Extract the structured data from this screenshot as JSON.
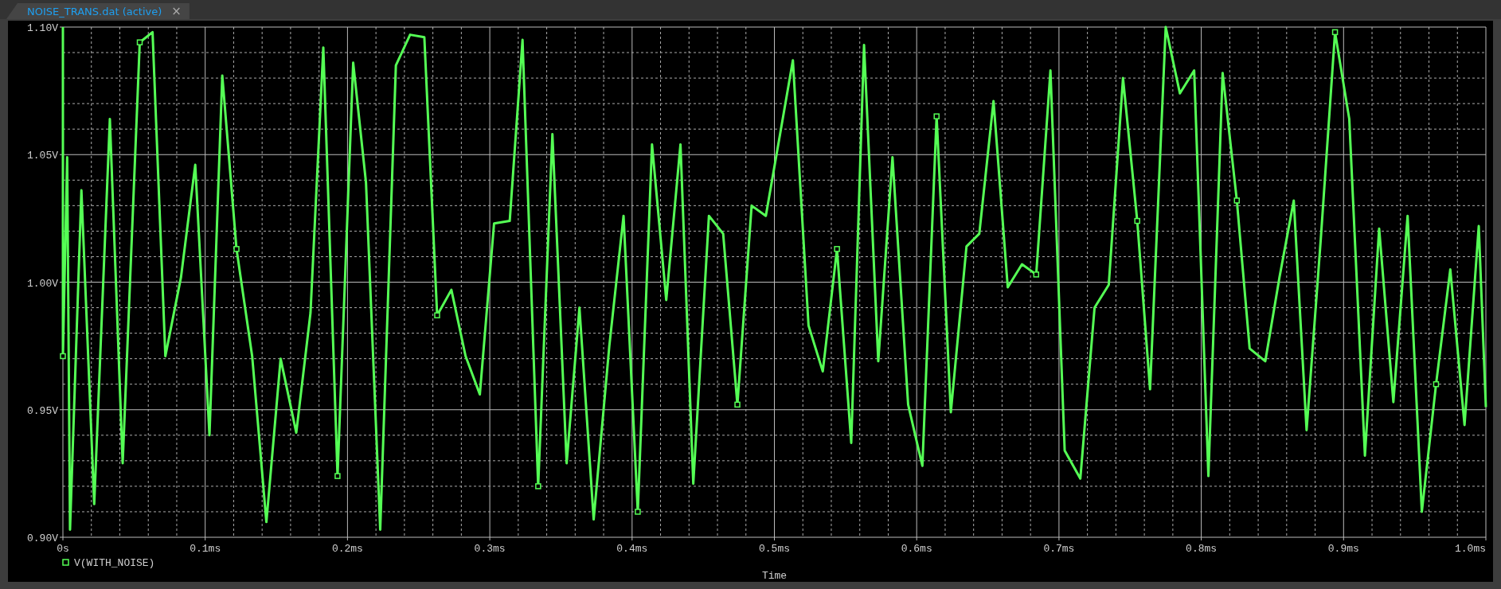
{
  "tab": {
    "title": "NOISE_TRANS.dat (active)",
    "close": "×",
    "selected": true
  },
  "chart": {
    "chart_data": {
      "type": "line",
      "grid": true,
      "xlabel": "Time",
      "xlim": [
        0,
        1
      ],
      "ylim": [
        0.9,
        1.1
      ],
      "xticks": [
        {
          "value": 0,
          "label": "0s"
        },
        {
          "value": 0.1,
          "label": "0.1ms"
        },
        {
          "value": 0.2,
          "label": "0.2ms"
        },
        {
          "value": 0.3,
          "label": "0.3ms"
        },
        {
          "value": 0.4,
          "label": "0.4ms"
        },
        {
          "value": 0.5,
          "label": "0.5ms"
        },
        {
          "value": 0.6,
          "label": "0.6ms"
        },
        {
          "value": 0.7,
          "label": "0.7ms"
        },
        {
          "value": 0.8,
          "label": "0.8ms"
        },
        {
          "value": 0.9,
          "label": "0.9ms"
        },
        {
          "value": 1,
          "label": "1.0ms"
        }
      ],
      "yticks": [
        {
          "value": 0.9,
          "label": "0.90V"
        },
        {
          "value": 0.95,
          "label": "0.95V"
        },
        {
          "value": 1,
          "label": "1.00V"
        },
        {
          "value": 1.05,
          "label": "1.05V"
        },
        {
          "value": 1.1,
          "label": "1.10V"
        }
      ],
      "x": [
        0,
        0,
        0.003,
        0.005,
        0.013,
        0.022,
        0.033,
        0.042,
        0.054,
        0.063,
        0.072,
        0.083,
        0.093,
        0.103,
        0.112,
        0.122,
        0.133,
        0.143,
        0.153,
        0.164,
        0.174,
        0.183,
        0.193,
        0.204,
        0.213,
        0.223,
        0.234,
        0.244,
        0.254,
        0.263,
        0.273,
        0.283,
        0.293,
        0.303,
        0.314,
        0.323,
        0.334,
        0.344,
        0.354,
        0.363,
        0.373,
        0.384,
        0.394,
        0.404,
        0.414,
        0.424,
        0.434,
        0.443,
        0.454,
        0.464,
        0.474,
        0.484,
        0.494,
        0.504,
        0.513,
        0.524,
        0.534,
        0.544,
        0.554,
        0.563,
        0.573,
        0.583,
        0.594,
        0.604,
        0.614,
        0.624,
        0.635,
        0.644,
        0.654,
        0.664,
        0.674,
        0.684,
        0.694,
        0.704,
        0.715,
        0.725,
        0.735,
        0.745,
        0.755,
        0.764,
        0.775,
        0.785,
        0.795,
        0.805,
        0.815,
        0.825,
        0.834,
        0.845,
        0.855,
        0.865,
        0.874,
        0.884,
        0.894,
        0.904,
        0.915,
        0.925,
        0.935,
        0.945,
        0.955,
        0.965,
        0.975,
        0.985,
        0.995,
        1
      ],
      "series": [
        {
          "name": "V(WITH_NOISE)",
          "color": "#55ff55",
          "values": [
            1.1,
            0.971,
            1.049,
            0.903,
            1.036,
            0.913,
            1.064,
            0.929,
            1.094,
            1.098,
            0.971,
            1.002,
            1.046,
            0.94,
            1.081,
            1.013,
            0.971,
            0.906,
            0.97,
            0.941,
            0.988,
            1.092,
            0.924,
            1.086,
            1.039,
            0.903,
            1.085,
            1.097,
            1.096,
            0.987,
            0.997,
            0.971,
            0.956,
            1.023,
            1.024,
            1.095,
            0.92,
            1.058,
            0.929,
            0.99,
            0.907,
            0.975,
            1.026,
            0.91,
            1.054,
            0.993,
            1.054,
            0.921,
            1.026,
            1.019,
            0.952,
            1.03,
            1.026,
            1.058,
            1.087,
            0.983,
            0.965,
            1.013,
            0.937,
            1.093,
            0.969,
            1.049,
            0.952,
            0.928,
            1.065,
            0.949,
            1.014,
            1.019,
            1.071,
            0.998,
            1.007,
            1.003,
            1.083,
            0.934,
            0.923,
            0.99,
            0.999,
            1.08,
            1.024,
            0.958,
            1.1,
            1.074,
            1.083,
            0.924,
            1.082,
            1.032,
            0.974,
            0.969,
            1.002,
            1.032,
            0.942,
            1.017,
            1.098,
            1.064,
            0.932,
            1.021,
            0.953,
            1.026,
            0.91,
            0.96,
            1.005,
            0.944,
            1.022,
            0.951
          ]
        }
      ]
    }
  }
}
